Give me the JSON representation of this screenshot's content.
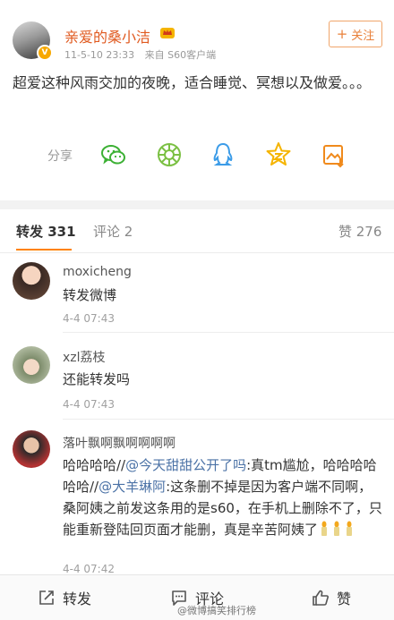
{
  "post": {
    "username": "亲爱的桑小洁",
    "time": "11-5-10 23:33",
    "source": "来自 S60客户端",
    "follow_label": "关注",
    "content": "超爱这种风雨交加的夜晚，适合睡觉、冥想以及做爱。。。",
    "share_label": "分享",
    "share_icons": [
      "wechat-icon",
      "moments-icon",
      "qq-icon",
      "qzone-icon",
      "save-image-icon"
    ]
  },
  "tabs": {
    "repost": "转发 331",
    "comment": "评论 2",
    "like": "赞 276"
  },
  "comments": [
    {
      "name": "moxicheng",
      "text": "转发微博",
      "time": "4-4 07:43"
    },
    {
      "name": "xzl荔枝",
      "text": "还能转发吗",
      "time": "4-4 07:43"
    },
    {
      "name": "落叶飘啊飘啊啊啊啊",
      "text_before": "哈哈哈哈//",
      "mention1": "@今天甜甜公开了吗",
      "text_mid": ":真tm尴尬，哈哈哈哈哈哈//",
      "mention2": "@大羊琳阿",
      "text_after": ":这条删不掉是因为客户端不同啊，桑阿姨之前发这条用的是s60，在手机上删除不了，只能重新登陆回页面才能删，真是辛苦阿姨了",
      "time": "4-4 07:42"
    }
  ],
  "bottom_bar": {
    "repost": "转发",
    "comment": "评论",
    "like": "赞"
  },
  "watermark": "@微博搞笑排行榜",
  "colors": {
    "username": "#e05a20",
    "accent": "#ff8200",
    "mention": "#4b72a6"
  }
}
